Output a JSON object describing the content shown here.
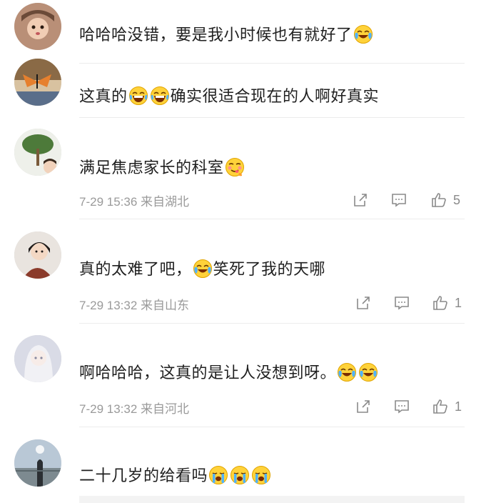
{
  "comments": [
    {
      "text": "哈哈哈没错，要是我小时候也有就好了",
      "emojis_after": [
        "laugh-cry-emoji"
      ],
      "meta": "",
      "likes": ""
    },
    {
      "text_before": "这真的",
      "emojis_mid": [
        "grin-emoji",
        "grin-emoji"
      ],
      "text_after": "确实很适合现在的人啊好真实",
      "meta": "",
      "likes": ""
    },
    {
      "text": "满足焦虑家长的科室",
      "emojis_after": [
        "yum-emoji"
      ],
      "meta": "7-29 15:36 来自湖北",
      "likes": "5"
    },
    {
      "text_before": "真的太难了吧，",
      "emojis_mid": [
        "laugh-cry-emoji"
      ],
      "text_after": "笑死了我的天哪",
      "meta": "7-29 13:32 来自山东",
      "likes": "1"
    },
    {
      "text": "啊哈哈哈，这真的是让人没想到呀。",
      "emojis_after": [
        "laugh-cry-emoji",
        "laugh-cry-emoji"
      ],
      "meta": "7-29 13:32 来自河北",
      "likes": "1"
    },
    {
      "text": "二十几岁的给看吗",
      "emojis_after": [
        "sob-emoji",
        "sob-emoji",
        "sob-emoji"
      ],
      "meta": "",
      "likes": ""
    }
  ],
  "icons": {
    "share": "share-icon",
    "comment": "comment-icon",
    "like": "thumbs-up-icon"
  },
  "colors": {
    "meta_gray": "#9a9a9a",
    "divider": "#ececec",
    "text": "#1f1f1f"
  }
}
